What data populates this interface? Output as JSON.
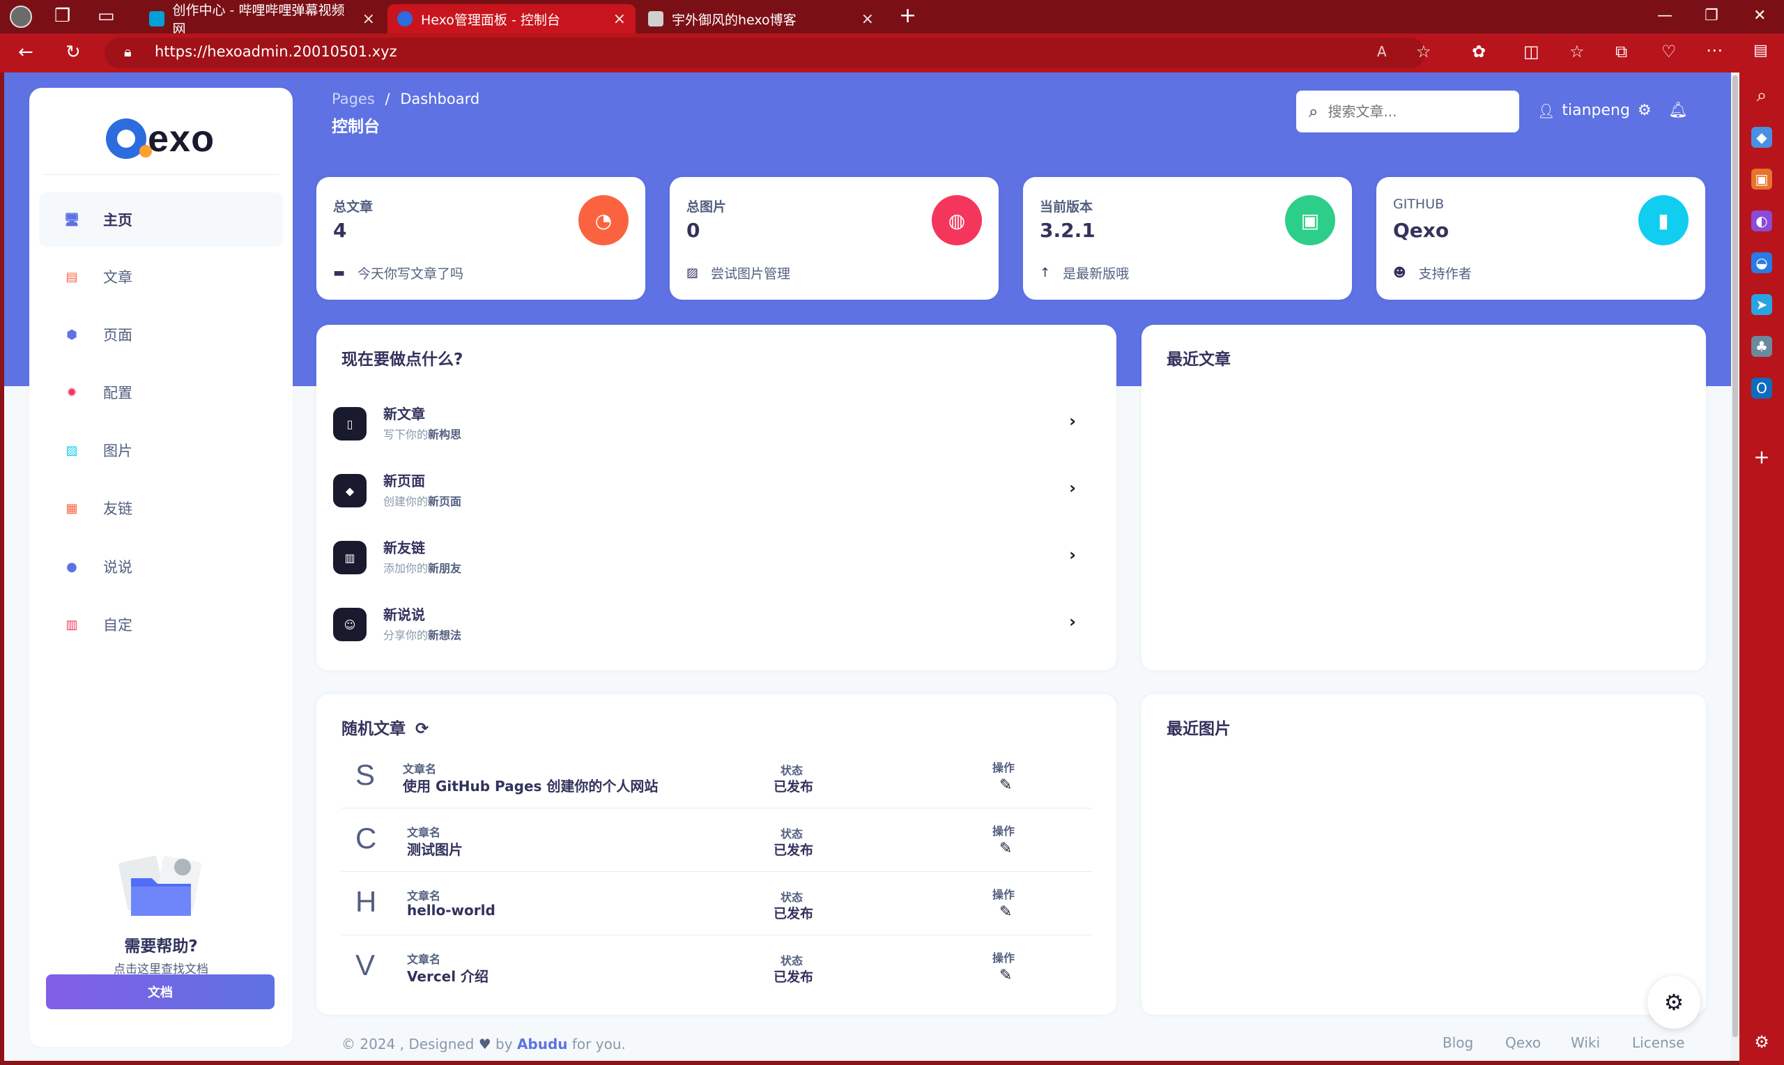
{
  "browser": {
    "tabs": [
      {
        "title": "创作中心 - 哔哩哔哩弹幕视频网",
        "active": false,
        "favicon_color": "#00a1d6"
      },
      {
        "title": "Hexo管理面板 - 控制台",
        "active": true,
        "favicon_color": "#2d6cdf"
      },
      {
        "title": "宇外御风的hexo博客",
        "active": false,
        "favicon_color": "#d0d0d0"
      }
    ],
    "url": "https://hexoadmin.20010501.xyz"
  },
  "sidebar": {
    "logo_text": "exo",
    "items": [
      {
        "label": "主页",
        "icon": "desktop-icon",
        "color": "#5e72e4",
        "active": true
      },
      {
        "label": "文章",
        "icon": "article-icon",
        "color": "#fb6340",
        "active": false
      },
      {
        "label": "页面",
        "icon": "cube-icon",
        "color": "#5e72e4",
        "active": false
      },
      {
        "label": "配置",
        "icon": "gear-icon",
        "color": "#f5365c",
        "active": false
      },
      {
        "label": "图片",
        "icon": "image-icon",
        "color": "#11cdef",
        "active": false
      },
      {
        "label": "友链",
        "icon": "link-icon",
        "color": "#fb6340",
        "active": false
      },
      {
        "label": "说说",
        "icon": "chat-icon",
        "color": "#5e72e4",
        "active": false
      },
      {
        "label": "自定",
        "icon": "tool-icon",
        "color": "#f5365c",
        "active": false
      }
    ],
    "help_title": "需要帮助?",
    "help_sub": "点击这里查找文档",
    "doc_button": "文档"
  },
  "header": {
    "breadcrumb_parent": "Pages",
    "breadcrumb_sep": "/",
    "breadcrumb_current": "Dashboard",
    "title": "控制台",
    "search_placeholder": "搜索文章...",
    "username": "tianpeng"
  },
  "stats": [
    {
      "label": "总文章",
      "value": "4",
      "foot": "今天你写文章了吗",
      "color": "#fb6340",
      "icon": "pie-chart-icon",
      "foot_icon": "archive-icon"
    },
    {
      "label": "总图片",
      "value": "0",
      "foot": "尝试图片管理",
      "color": "#f5365c",
      "icon": "globe-icon",
      "foot_icon": "images-icon"
    },
    {
      "label": "当前版本",
      "value": "3.2.1",
      "foot": "是最新版哦",
      "color": "#2dce89",
      "icon": "badge-icon",
      "foot_icon": "arrow-up-icon"
    },
    {
      "label": "GITHUB",
      "value": "Qexo",
      "foot": "支持作者",
      "color": "#11cdef",
      "icon": "bar-chart-icon",
      "foot_icon": "github-icon"
    }
  ],
  "actions": {
    "title": "现在要做点什么?",
    "items": [
      {
        "title": "新文章",
        "sub_prefix": "写下你的",
        "sub_bold": "新构思"
      },
      {
        "title": "新页面",
        "sub_prefix": "创建你的",
        "sub_bold": "新页面"
      },
      {
        "title": "新友链",
        "sub_prefix": "添加你的",
        "sub_bold": "新朋友"
      },
      {
        "title": "新说说",
        "sub_prefix": "分享你的",
        "sub_bold": "新想法"
      }
    ]
  },
  "recent_posts": {
    "title": "最近文章"
  },
  "random_posts": {
    "title": "随机文章",
    "name_label": "文章名",
    "status_label": "状态",
    "op_label": "操作",
    "rows": [
      {
        "letter": "S",
        "name": "使用 GitHub Pages 创建你的个人网站",
        "status": "已发布"
      },
      {
        "letter": "C",
        "name": "测试图片",
        "status": "已发布"
      },
      {
        "letter": "H",
        "name": "hello-world",
        "status": "已发布"
      },
      {
        "letter": "V",
        "name": "Vercel 介绍",
        "status": "已发布"
      }
    ]
  },
  "recent_images": {
    "title": "最近图片"
  },
  "footer": {
    "copy_prefix": "© 2024 , Designed",
    "copy_by": "by",
    "author": "Abudu",
    "copy_suffix": "for you.",
    "links": [
      "Blog",
      "Qexo",
      "Wiki",
      "License"
    ]
  }
}
